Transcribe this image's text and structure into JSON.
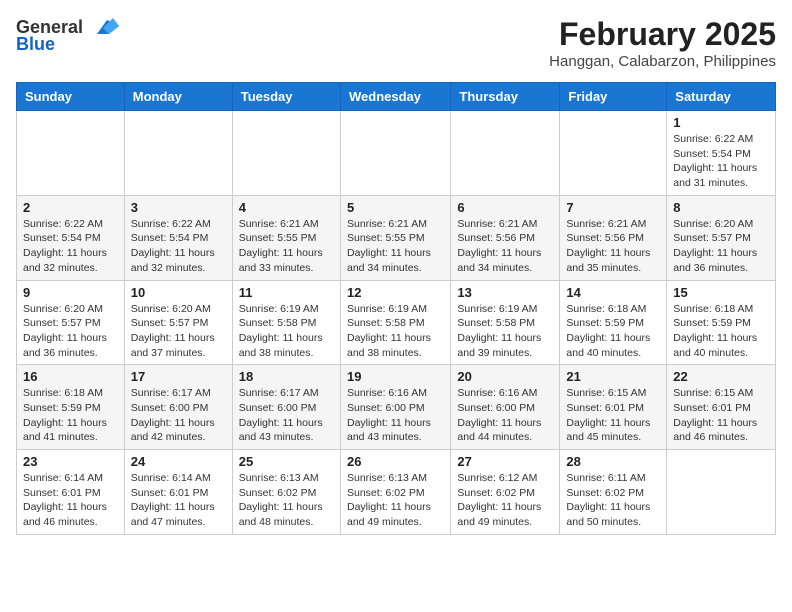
{
  "logo": {
    "general": "General",
    "blue": "Blue"
  },
  "title": "February 2025",
  "subtitle": "Hanggan, Calabarzon, Philippines",
  "weekdays": [
    "Sunday",
    "Monday",
    "Tuesday",
    "Wednesday",
    "Thursday",
    "Friday",
    "Saturday"
  ],
  "weeks": [
    [
      {
        "day": "",
        "info": ""
      },
      {
        "day": "",
        "info": ""
      },
      {
        "day": "",
        "info": ""
      },
      {
        "day": "",
        "info": ""
      },
      {
        "day": "",
        "info": ""
      },
      {
        "day": "",
        "info": ""
      },
      {
        "day": "1",
        "info": "Sunrise: 6:22 AM\nSunset: 5:54 PM\nDaylight: 11 hours and 31 minutes."
      }
    ],
    [
      {
        "day": "2",
        "info": "Sunrise: 6:22 AM\nSunset: 5:54 PM\nDaylight: 11 hours and 32 minutes."
      },
      {
        "day": "3",
        "info": "Sunrise: 6:22 AM\nSunset: 5:54 PM\nDaylight: 11 hours and 32 minutes."
      },
      {
        "day": "4",
        "info": "Sunrise: 6:21 AM\nSunset: 5:55 PM\nDaylight: 11 hours and 33 minutes."
      },
      {
        "day": "5",
        "info": "Sunrise: 6:21 AM\nSunset: 5:55 PM\nDaylight: 11 hours and 34 minutes."
      },
      {
        "day": "6",
        "info": "Sunrise: 6:21 AM\nSunset: 5:56 PM\nDaylight: 11 hours and 34 minutes."
      },
      {
        "day": "7",
        "info": "Sunrise: 6:21 AM\nSunset: 5:56 PM\nDaylight: 11 hours and 35 minutes."
      },
      {
        "day": "8",
        "info": "Sunrise: 6:20 AM\nSunset: 5:57 PM\nDaylight: 11 hours and 36 minutes."
      }
    ],
    [
      {
        "day": "9",
        "info": "Sunrise: 6:20 AM\nSunset: 5:57 PM\nDaylight: 11 hours and 36 minutes."
      },
      {
        "day": "10",
        "info": "Sunrise: 6:20 AM\nSunset: 5:57 PM\nDaylight: 11 hours and 37 minutes."
      },
      {
        "day": "11",
        "info": "Sunrise: 6:19 AM\nSunset: 5:58 PM\nDaylight: 11 hours and 38 minutes."
      },
      {
        "day": "12",
        "info": "Sunrise: 6:19 AM\nSunset: 5:58 PM\nDaylight: 11 hours and 38 minutes."
      },
      {
        "day": "13",
        "info": "Sunrise: 6:19 AM\nSunset: 5:58 PM\nDaylight: 11 hours and 39 minutes."
      },
      {
        "day": "14",
        "info": "Sunrise: 6:18 AM\nSunset: 5:59 PM\nDaylight: 11 hours and 40 minutes."
      },
      {
        "day": "15",
        "info": "Sunrise: 6:18 AM\nSunset: 5:59 PM\nDaylight: 11 hours and 40 minutes."
      }
    ],
    [
      {
        "day": "16",
        "info": "Sunrise: 6:18 AM\nSunset: 5:59 PM\nDaylight: 11 hours and 41 minutes."
      },
      {
        "day": "17",
        "info": "Sunrise: 6:17 AM\nSunset: 6:00 PM\nDaylight: 11 hours and 42 minutes."
      },
      {
        "day": "18",
        "info": "Sunrise: 6:17 AM\nSunset: 6:00 PM\nDaylight: 11 hours and 43 minutes."
      },
      {
        "day": "19",
        "info": "Sunrise: 6:16 AM\nSunset: 6:00 PM\nDaylight: 11 hours and 43 minutes."
      },
      {
        "day": "20",
        "info": "Sunrise: 6:16 AM\nSunset: 6:00 PM\nDaylight: 11 hours and 44 minutes."
      },
      {
        "day": "21",
        "info": "Sunrise: 6:15 AM\nSunset: 6:01 PM\nDaylight: 11 hours and 45 minutes."
      },
      {
        "day": "22",
        "info": "Sunrise: 6:15 AM\nSunset: 6:01 PM\nDaylight: 11 hours and 46 minutes."
      }
    ],
    [
      {
        "day": "23",
        "info": "Sunrise: 6:14 AM\nSunset: 6:01 PM\nDaylight: 11 hours and 46 minutes."
      },
      {
        "day": "24",
        "info": "Sunrise: 6:14 AM\nSunset: 6:01 PM\nDaylight: 11 hours and 47 minutes."
      },
      {
        "day": "25",
        "info": "Sunrise: 6:13 AM\nSunset: 6:02 PM\nDaylight: 11 hours and 48 minutes."
      },
      {
        "day": "26",
        "info": "Sunrise: 6:13 AM\nSunset: 6:02 PM\nDaylight: 11 hours and 49 minutes."
      },
      {
        "day": "27",
        "info": "Sunrise: 6:12 AM\nSunset: 6:02 PM\nDaylight: 11 hours and 49 minutes."
      },
      {
        "day": "28",
        "info": "Sunrise: 6:11 AM\nSunset: 6:02 PM\nDaylight: 11 hours and 50 minutes."
      },
      {
        "day": "",
        "info": ""
      }
    ]
  ]
}
